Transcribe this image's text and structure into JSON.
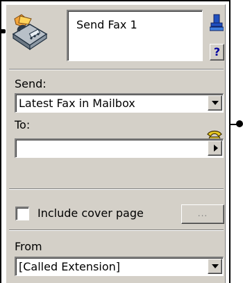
{
  "header": {
    "name": "Send Fax 1",
    "help_label": "?"
  },
  "send": {
    "label": "Send:",
    "value": "Latest Fax in Mailbox"
  },
  "to": {
    "label": "To:",
    "value": ""
  },
  "cover_page": {
    "label": "Include cover page",
    "checked": false,
    "button_label": "..."
  },
  "from": {
    "label": "From",
    "value": "[Called Extension]"
  },
  "icons": {
    "fax": "fax-machine-icon",
    "stamp": "stamp-icon",
    "phone": "phone-icon"
  }
}
